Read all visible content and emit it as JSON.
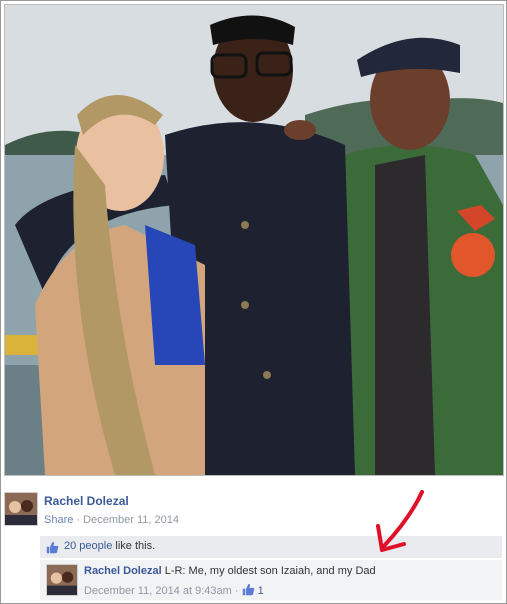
{
  "post": {
    "author": "Rachel Dolezal",
    "share_label": "Share",
    "separator": "·",
    "date": "December 11, 2014",
    "likes_count_text": "20 people",
    "likes_suffix": " like this."
  },
  "comment": {
    "author": "Rachel Dolezal",
    "text": " L-R: Me, my oldest son Izaiah, and my Dad",
    "timestamp": "December 11, 2014 at 9:43am",
    "separator": "·",
    "like_count": "1"
  },
  "colors": {
    "link_blue": "#3b5998",
    "meta_gray": "#9197a3",
    "annotation_red": "#e0102a"
  },
  "icons": {
    "like": "thumbs-up-icon",
    "arrow": "red-arrow-annotation"
  }
}
